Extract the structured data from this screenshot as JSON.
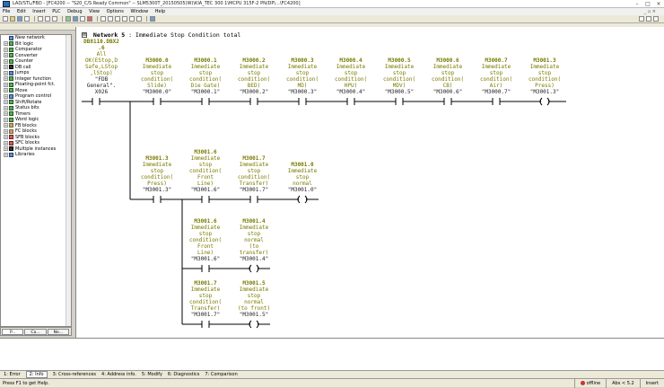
{
  "window": {
    "title": "LAD/STL/FBD - [FC4200 -- \"S20_C/S Ready Common\" -- SLM5300T_20150505(W)\\KIA_TEC 300 1\\MCPU 315F-2 PN/DP\\...\\FC4200]"
  },
  "menu": {
    "items": [
      "File",
      "Edit",
      "Insert",
      "PLC",
      "Debug",
      "View",
      "Options",
      "Window",
      "Help"
    ],
    "right": "_ ▫ ×"
  },
  "tree": {
    "items": [
      {
        "label": "New network",
        "icon": "new-network-icon"
      },
      {
        "label": "Bit logic",
        "icon": "bit-logic-icon"
      },
      {
        "label": "Comparator",
        "icon": "comparator-icon"
      },
      {
        "label": "Converter",
        "icon": "converter-icon"
      },
      {
        "label": "Counter",
        "icon": "counter-icon"
      },
      {
        "label": "DB call",
        "icon": "db-call-icon"
      },
      {
        "label": "Jumps",
        "icon": "jumps-icon"
      },
      {
        "label": "Integer function",
        "icon": "integer-function-icon"
      },
      {
        "label": "Floating-point fct.",
        "icon": "floating-point-icon"
      },
      {
        "label": "Move",
        "icon": "move-icon"
      },
      {
        "label": "Program control",
        "icon": "program-control-icon"
      },
      {
        "label": "Shift/Rotate",
        "icon": "shift-rotate-icon"
      },
      {
        "label": "Status bits",
        "icon": "status-bits-icon"
      },
      {
        "label": "Timers",
        "icon": "timers-icon"
      },
      {
        "label": "Word logic",
        "icon": "word-logic-icon"
      },
      {
        "label": "FB blocks",
        "icon": "fb-blocks-icon"
      },
      {
        "label": "FC blocks",
        "icon": "fc-blocks-icon"
      },
      {
        "label": "SFB blocks",
        "icon": "sfb-blocks-icon"
      },
      {
        "label": "SFC blocks",
        "icon": "sfc-blocks-icon"
      },
      {
        "label": "Multiple instances",
        "icon": "multiple-instances-icon"
      },
      {
        "label": "Libraries",
        "icon": "libraries-icon"
      }
    ],
    "tabs": [
      "P...",
      "Ca...",
      "Ne..."
    ]
  },
  "network": {
    "collapse_glyph": "⊟",
    "label": "Network 5",
    "title": ": Immediate Stop Condition total",
    "first_contact": {
      "addr": "DB8110.DBX2\n.6",
      "comment": "All\nOK(EStop,D\nSafe,LStop\n,lStop)",
      "symbol": "\"FDB\nGeneral\".\nX026"
    },
    "row1": [
      {
        "addr": "M3000.0",
        "comment": "Immediate\nstop\ncondition(\nSlide)",
        "symbol": "\"M3000.0\""
      },
      {
        "addr": "M3000.1",
        "comment": "Immediate\nstop\ncondition(\nDie Gate)",
        "symbol": "\"M3000.1\""
      },
      {
        "addr": "M3000.2",
        "comment": "Immediate\nstop\ncondition(\nBED)",
        "symbol": "\"M3000.2\""
      },
      {
        "addr": "M3000.3",
        "comment": "Immediate\nstop\ncondition(\nMD)",
        "symbol": "\"M3000.3\""
      },
      {
        "addr": "M3000.4",
        "comment": "Immediate\nstop\ncondition(\nHPU)",
        "symbol": "\"M3000.4\""
      },
      {
        "addr": "M3000.5",
        "comment": "Immediate\nstop\ncondition(\nMDV)",
        "symbol": "\"M3000.5\""
      },
      {
        "addr": "M3000.6",
        "comment": "Immediate\nstop\ncondition(\nCB)",
        "symbol": "\"M3000.6\""
      },
      {
        "addr": "M3000.7",
        "comment": "Immediate\nstop\ncondition(\nAir)",
        "symbol": "\"M3000.7\""
      },
      {
        "addr": "M3001.3",
        "comment": "Immediate\nstop\ncondition(\nPress)",
        "symbol": "\"M3001.3\""
      }
    ],
    "row2": [
      {
        "addr": "M3001.3",
        "comment": "Immediate\nstop\ncondition(\nPress)",
        "symbol": "\"M3001.3\""
      },
      {
        "addr": "M3001.6",
        "comment": "Immediate\nstop\ncondition(\nFront\nLine)",
        "symbol": "\"M3001.6\""
      },
      {
        "addr": "M3001.7",
        "comment": "Immediate\nstop\ncondition(\nTransfer)",
        "symbol": "\"M3001.7\""
      },
      {
        "addr": "M3001.0",
        "comment": "Immediate\nstop\nnormal",
        "symbol": "\"M3001.0\""
      }
    ],
    "row3": [
      {
        "addr": "M3001.6",
        "comment": "Immediate\nstop\ncondition(\nFront\nLine)",
        "symbol": "\"M3001.6\""
      },
      {
        "addr": "M3001.4",
        "comment": "Immediate\nstop\nnormal\n(to\ntransfer)",
        "symbol": "\"M3001.4\""
      }
    ],
    "row4": [
      {
        "addr": "M3001.7",
        "comment": "Immediate\nstop\ncondition(\nTransfer)",
        "symbol": "\"M3001.7\""
      },
      {
        "addr": "M3001.5",
        "comment": "Immediate\nstop\nnormal\n(to front)",
        "symbol": "\"M3001.5\""
      }
    ]
  },
  "bottom_tabs": [
    "1: Error",
    "2: Info",
    "3: Cross-references",
    "4: Address info.",
    "5: Modify",
    "6: Diagnostics",
    "7: Comparison"
  ],
  "status": {
    "help": "Press F1 to get Help.",
    "mode": "offline",
    "position": "Abs < 5.2",
    "insert": "Insert"
  },
  "colors": {
    "rung_text": "#7a7a00",
    "rung_line": "#000000"
  }
}
